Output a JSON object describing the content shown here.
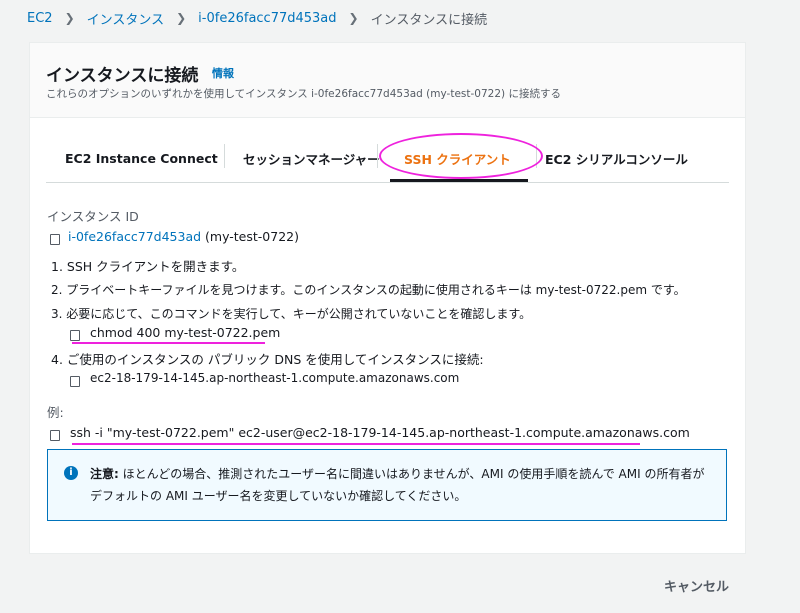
{
  "breadcrumb": {
    "items": [
      "EC2",
      "インスタンス",
      "i-0fe26facc77d453ad",
      "インスタンスに接続"
    ]
  },
  "header": {
    "title": "インスタンスに接続",
    "info": "情報",
    "description": "これらのオプションのいずれかを使用してインスタンス i-0fe26facc77d453ad (my-test-0722) に接続する"
  },
  "tabs": [
    {
      "label": "EC2 Instance Connect"
    },
    {
      "label": "セッションマネージャー"
    },
    {
      "label": "SSH クライアント"
    },
    {
      "label": "EC2 シリアルコンソール"
    }
  ],
  "content": {
    "instance_id_label": "インスタンス ID",
    "instance_id": "i-0fe26facc77d453ad",
    "instance_name": "(my-test-0722)",
    "step1": "1. SSH クライアントを開きます。",
    "step2": "2. プライベートキーファイルを見つけます。このインスタンスの起動に使用されるキーは my-test-0722.pem です。",
    "step3": "3. 必要に応じて、このコマンドを実行して、キーが公開されていないことを確認します。",
    "chmod_cmd": "chmod 400 my-test-0722.pem",
    "step4": "4. ご使用のインスタンスの パブリック DNS を使用してインスタンスに接続:",
    "dns": "ec2-18-179-14-145.ap-northeast-1.compute.amazonaws.com",
    "example_label": "例:",
    "ssh_cmd": "ssh -i \"my-test-0722.pem\" ec2-user@ec2-18-179-14-145.ap-northeast-1.compute.amazonaws.com"
  },
  "note": {
    "icon": "info-icon",
    "bold": "注意:",
    "text": " ほとんどの場合、推測されたユーザー名に間違いはありませんが、AMI の使用手順を読んで AMI の所有者がデフォルトの AMI ユーザー名を変更していないか確認してください。"
  },
  "footer": {
    "cancel": "キャンセル"
  },
  "colors": {
    "link": "#0073bb",
    "active_tab": "#ec7211",
    "annotation": "#ee22dd"
  }
}
